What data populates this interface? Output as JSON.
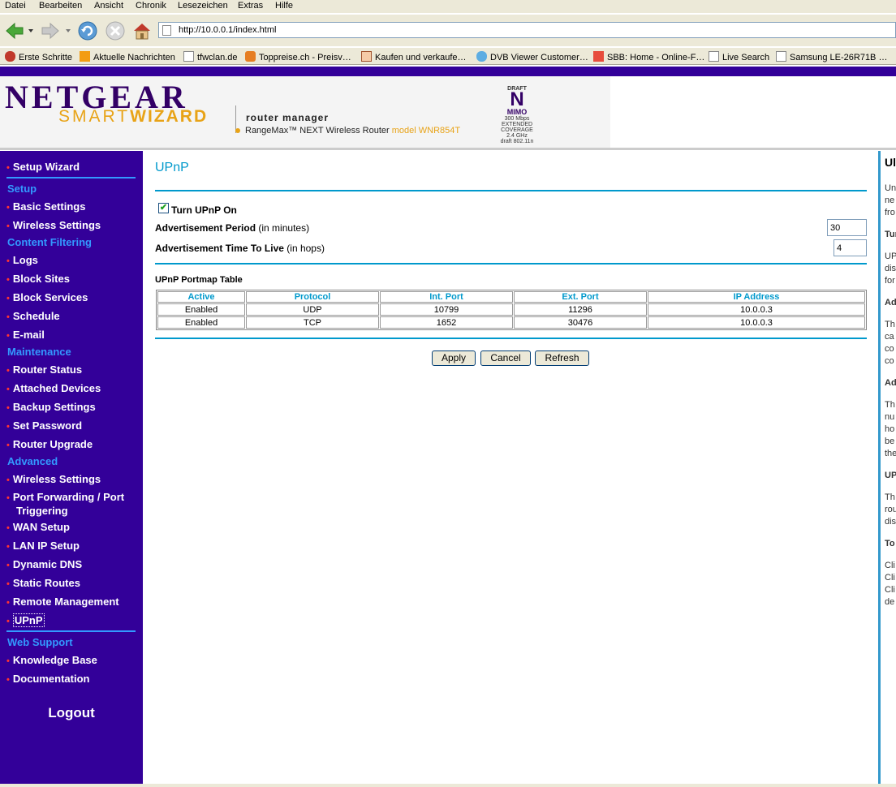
{
  "browser": {
    "menu": [
      "Datei",
      "Bearbeiten",
      "Ansicht",
      "Chronik",
      "Lesezeichen",
      "Extras",
      "Hilfe"
    ],
    "url": "http://10.0.0.1/index.html",
    "bookmarks": [
      "Erste Schritte",
      "Aktuelle Nachrichten",
      "tfwclan.de",
      "Toppreise.ch - Preisv…",
      "Kaufen und verkaufe…",
      "DVB Viewer Customer…",
      "SBB: Home - Online-F…",
      "Live Search",
      "Samsung LE-26R71B …"
    ]
  },
  "banner": {
    "brand": "NETGEAR",
    "smart": "SMART",
    "wizard": "WIZARD",
    "router_manager": "router manager",
    "subtitle": "RangeMax™ NEXT Wireless Router",
    "model": "model WNR854T",
    "badge": {
      "draft": "DRAFT",
      "n": "N",
      "mimo": "MIMO",
      "speed": "300 Mbps",
      "ext": "EXTENDED",
      "cov": "COVERAGE",
      "ghz": "2.4 GHz",
      "std": "draft 802.11n"
    }
  },
  "sidebar": {
    "setup_wizard": "Setup Wizard",
    "sections": {
      "setup": "Setup",
      "content_filtering": "Content Filtering",
      "maintenance": "Maintenance",
      "advanced": "Advanced",
      "web_support": "Web Support"
    },
    "items": {
      "basic_settings": "Basic Settings",
      "wireless_settings": "Wireless Settings",
      "logs": "Logs",
      "block_sites": "Block Sites",
      "block_services": "Block Services",
      "schedule": "Schedule",
      "email": "E-mail",
      "router_status": "Router Status",
      "attached_devices": "Attached Devices",
      "backup_settings": "Backup Settings",
      "set_password": "Set Password",
      "router_upgrade": "Router Upgrade",
      "adv_wireless_settings": "Wireless Settings",
      "port_forwarding": "Port Forwarding / Port Triggering",
      "wan_setup": "WAN Setup",
      "lan_ip_setup": "LAN IP Setup",
      "dynamic_dns": "Dynamic DNS",
      "static_routes": "Static Routes",
      "remote_management": "Remote Management",
      "upnp": "UPnP",
      "knowledge_base": "Knowledge Base",
      "documentation": "Documentation"
    },
    "logout": "Logout"
  },
  "main": {
    "title": "UPnP",
    "turn_on_label": "Turn UPnP On",
    "turn_on_checked": true,
    "adv_period_label": "Advertisement Period",
    "adv_period_unit": "(in minutes)",
    "adv_period_value": "30",
    "adv_ttl_label": "Advertisement Time To Live",
    "adv_ttl_unit": "(in hops)",
    "adv_ttl_value": "4",
    "portmap_title": "UPnP Portmap Table",
    "table": {
      "headers": [
        "Active",
        "Protocol",
        "Int. Port",
        "Ext. Port",
        "IP Address"
      ],
      "rows": [
        [
          "Enabled",
          "UDP",
          "10799",
          "11296",
          "10.0.0.3"
        ],
        [
          "Enabled",
          "TCP",
          "1652",
          "30476",
          "10.0.0.3"
        ]
      ]
    },
    "buttons": {
      "apply": "Apply",
      "cancel": "Cancel",
      "refresh": "Refresh"
    }
  },
  "help": {
    "fragments": [
      "Ul",
      "Un",
      "ne",
      "fro",
      "Tur",
      "UP",
      "dis",
      "for",
      "Ad",
      "Th",
      "ca",
      "co",
      "co",
      "Ad",
      "Th",
      "nu",
      "ho",
      "be",
      "the",
      "UP",
      "Th",
      "rou",
      "dis",
      "To",
      "Cli",
      "Cli",
      "Cli",
      "de"
    ]
  },
  "colors": {
    "sidebar_bg": "#330099",
    "accent": "#0099cc",
    "section_head": "#3399ff",
    "bullet": "#ff3333",
    "wizard": "#e8a317"
  }
}
